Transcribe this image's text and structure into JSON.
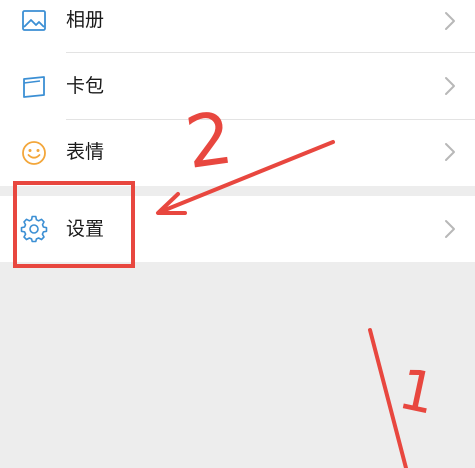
{
  "menu": {
    "album": {
      "label": "相册",
      "icon": "photo-icon"
    },
    "card_wallet": {
      "label": "卡包",
      "icon": "card-wallet-icon"
    },
    "sticker": {
      "label": "表情",
      "icon": "smiley-icon"
    },
    "settings": {
      "label": "设置",
      "icon": "gear-icon"
    }
  },
  "annotations": {
    "step_two_label": "2",
    "step_one_label": "1",
    "color": "#e8473f"
  },
  "colors": {
    "icon_blue": "#3b8fd4",
    "icon_orange": "#f3a63a",
    "text": "#1a1a1a",
    "chevron": "#b8b8b8",
    "background": "#ededed"
  }
}
